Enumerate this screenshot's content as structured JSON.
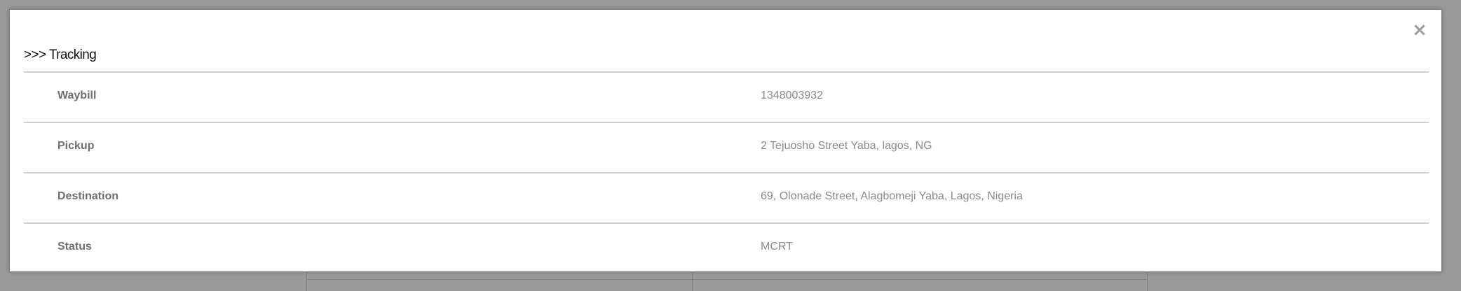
{
  "modal": {
    "title": ">>> Tracking",
    "close_symbol": "×"
  },
  "tracking": {
    "rows": [
      {
        "label": "Waybill",
        "value": "1348003932"
      },
      {
        "label": "Pickup",
        "value": "2 Tejuosho Street Yaba, lagos, NG"
      },
      {
        "label": "Destination",
        "value": "69, Olonade Street, Alagbomeji Yaba, Lagos, Nigeria"
      },
      {
        "label": "Status",
        "value": "MCRT"
      }
    ]
  }
}
